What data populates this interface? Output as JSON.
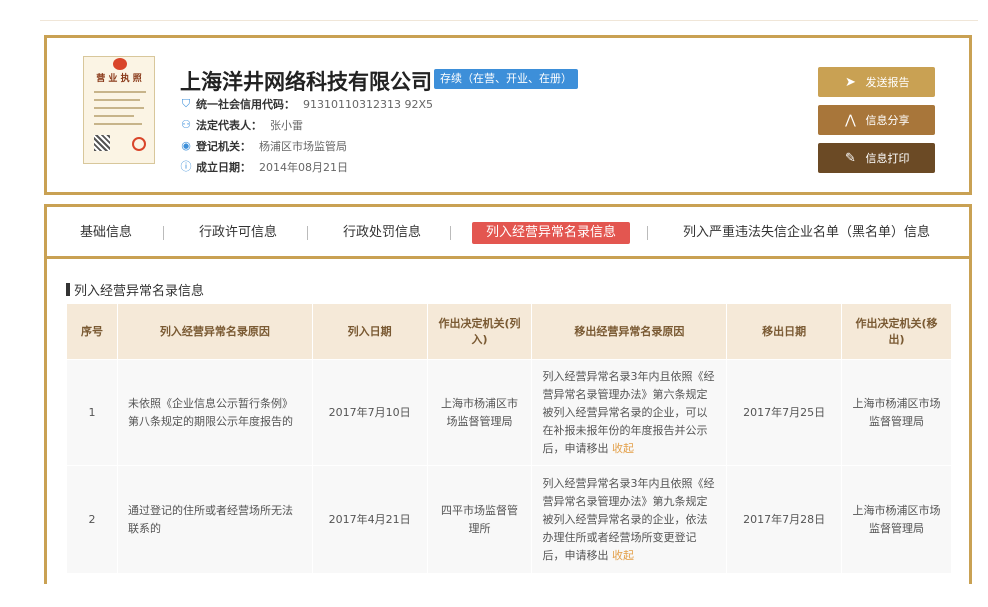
{
  "company": {
    "name": "上海洋井网络科技有限公司",
    "status": "存续（在营、开业、在册）",
    "license_image_title": "营 业 执 照",
    "fields": [
      {
        "label": "统一社会信用代码：",
        "value": "91310110312313 92X5",
        "icon": "shield-icon"
      },
      {
        "label": "法定代表人：",
        "value": "张小雷",
        "icon": "person-icon"
      },
      {
        "label": "登记机关：",
        "value": "杨浦区市场监管局",
        "icon": "location-icon"
      },
      {
        "label": "成立日期：",
        "value": "2014年08月21日",
        "icon": "info-icon"
      }
    ]
  },
  "actions": [
    {
      "label": "发送报告",
      "icon": "send-icon",
      "color": "#c9a153"
    },
    {
      "label": "信息分享",
      "icon": "share-icon",
      "color": "#a8763a"
    },
    {
      "label": "信息打印",
      "icon": "print-icon",
      "color": "#6b4a25"
    }
  ],
  "tabs": [
    {
      "label": "基础信息"
    },
    {
      "label": "行政许可信息"
    },
    {
      "label": "行政处罚信息"
    },
    {
      "label": "列入经营异常名录信息",
      "active": true
    },
    {
      "label": "列入严重违法失信企业名单（黑名单）信息"
    }
  ],
  "section_title": "列入经营异常名录信息",
  "table": {
    "headers": [
      "序号",
      "列入经营异常名录原因",
      "列入日期",
      "作出决定机关(列入)",
      "移出经营异常名录原因",
      "移出日期",
      "作出决定机关(移出)"
    ],
    "rows": [
      {
        "no": "1",
        "reason": "未依照《企业信息公示暂行条例》第八条规定的期限公示年度报告的",
        "date_in": "2017年7月10日",
        "authority_in": "上海市杨浦区市场监督管理局",
        "remove_reason": "列入经营异常名录3年内且依照《经营异常名录管理办法》第六条规定被列入经营异常名录的企业，可以在补报未报年份的年度报告并公示后，申请移出",
        "collapse": "收起",
        "date_out": "2017年7月25日",
        "authority_out": "上海市杨浦区市场监督管理局"
      },
      {
        "no": "2",
        "reason": "通过登记的住所或者经营场所无法联系的",
        "date_in": "2017年4月21日",
        "authority_in": "四平市场监督管理所",
        "remove_reason": "列入经营异常名录3年内且依照《经营异常名录管理办法》第九条规定被列入经营异常名录的企业，依法办理住所或者经营场所变更登记后，申请移出",
        "collapse": "收起",
        "date_out": "2017年7月28日",
        "authority_out": "上海市杨浦区市场监督管理局"
      }
    ]
  },
  "colors": {
    "gold_border": "#c9a153",
    "badge_blue": "#3d8fd9",
    "active_tab_red": "#e35650",
    "header_bg": "#f5e9d8"
  }
}
